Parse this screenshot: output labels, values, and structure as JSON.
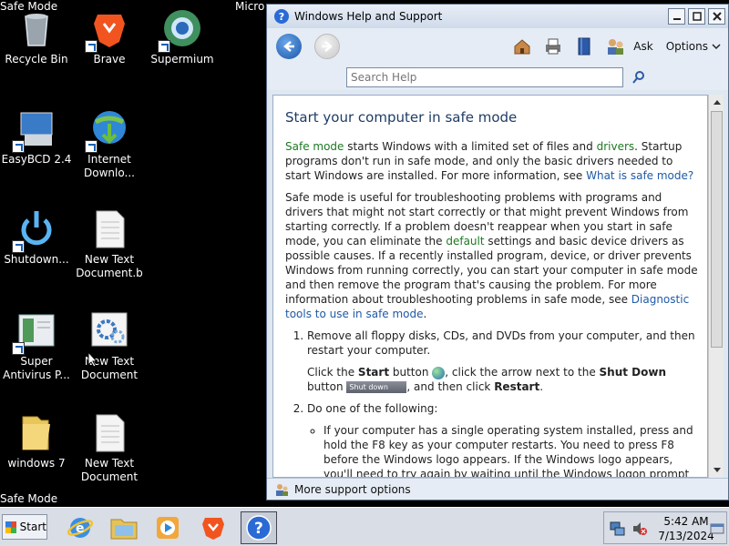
{
  "desktop": {
    "corner_top": "Safe Mode",
    "corner_bottom": "Safe Mode",
    "partial_label": "Micro",
    "icons": [
      {
        "label": "Recycle Bin",
        "icon": "recycle-bin-icon"
      },
      {
        "label": "Brave",
        "icon": "brave-icon"
      },
      {
        "label": "Supermium",
        "icon": "supermium-icon"
      },
      {
        "label": "EasyBCD 2.4",
        "icon": "easybcd-icon"
      },
      {
        "label": "Internet Downlo...",
        "icon": "internet-download-manager-icon"
      },
      {
        "label": "Shutdown...",
        "icon": "shutdown-icon"
      },
      {
        "label": "New Text Document.b",
        "icon": "text-document-icon"
      },
      {
        "label": "Super Antivirus P...",
        "icon": "antivirus-icon"
      },
      {
        "label": "New Text Document",
        "icon": "settings-document-icon"
      },
      {
        "label": "windows 7",
        "icon": "folder-icon"
      },
      {
        "label": "New Text Document",
        "icon": "text-document-icon"
      }
    ]
  },
  "help_window": {
    "title": "Windows Help and Support",
    "toolbar": {
      "ask_label": "Ask",
      "options_label": "Options"
    },
    "search": {
      "placeholder": "Search Help"
    },
    "article": {
      "heading": "Start your computer in safe mode",
      "p1": {
        "link1": "Safe mode",
        "t1": " starts Windows with a limited set of files and ",
        "link2": "drivers",
        "t2": ". Startup programs don't run in safe mode, and only the basic drivers needed to start Windows are installed. For more information, see ",
        "link3": "What is safe mode?"
      },
      "p2": {
        "t1": "Safe mode is useful for troubleshooting problems with programs and drivers that might not start correctly or that might prevent Windows from starting correctly. If a problem doesn't reappear when you start in safe mode, you can eliminate the ",
        "link1": "default",
        "t2": " settings and basic device drivers as possible causes. If a recently installed program, device, or driver prevents Windows from running correctly, you can start your computer in safe mode and then remove the program that's causing the problem. For more information about troubleshooting problems in safe mode, see ",
        "link2": "Diagnostic tools to use in safe mode",
        "t3": "."
      },
      "step1": {
        "text": "Remove all floppy disks, CDs, and DVDs from your computer, and then restart your computer.",
        "click": "Click the ",
        "start_bold": "Start",
        "button_word": " button ",
        "then_arrow": ", click the arrow next to the ",
        "shutdown_bold": "Shut Down",
        "button_word2": " button",
        "shutdown_img_label": "Shut down",
        "then_click": ", and then click ",
        "restart_bold": "Restart",
        "period": "."
      },
      "step2": {
        "text": "Do one of the following:",
        "bullet1": "If your computer has a single operating system installed, press and hold the F8 key as your computer restarts. You need to press F8 before the Windows logo appears. If the Windows logo appears, you'll need to try again by waiting until the Windows logon prompt appears, and then shutting down and restarting your computer."
      }
    },
    "status": {
      "label": "More support options"
    }
  },
  "taskbar": {
    "start_label": "Start",
    "clock_time": "5:42 AM",
    "clock_date": "7/13/2024"
  }
}
